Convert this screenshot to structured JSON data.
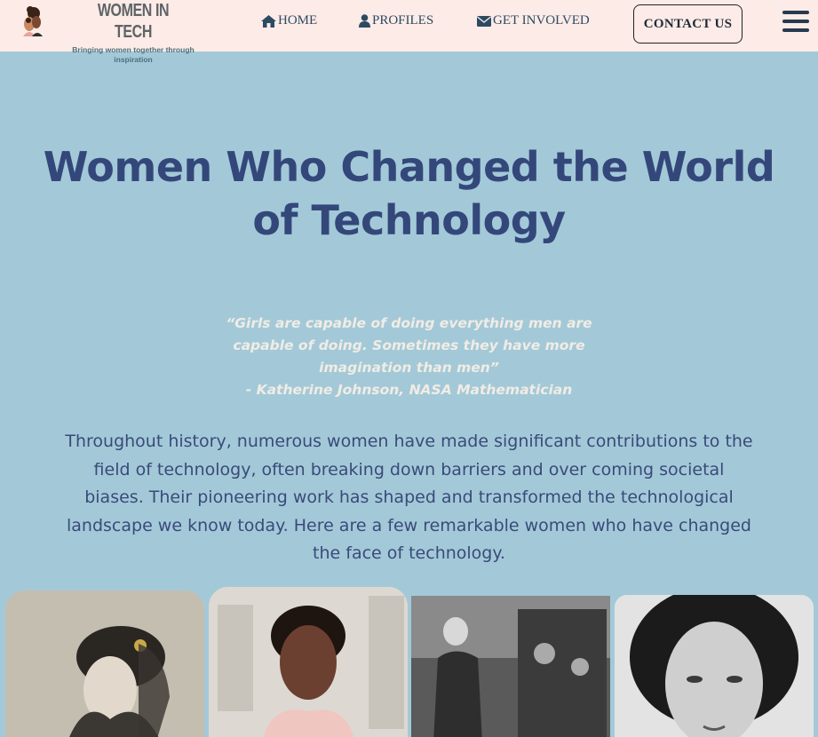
{
  "header": {
    "brand_title": "WOMEN IN TECH",
    "brand_tagline": "Bringing women together through inspiration",
    "nav": [
      {
        "label": "HOME",
        "icon": "home-icon"
      },
      {
        "label": "PROFILES",
        "icon": "user-icon"
      },
      {
        "label": "GET INVOLVED",
        "icon": "envelope-icon"
      }
    ],
    "contact_label": "CONTACT US",
    "menu_icon": "hamburger-icon"
  },
  "hero": {
    "title": "Women Who Changed the World of Technology",
    "quote_lines": [
      "“Girls are capable of doing everything men are",
      "capable of doing. Sometimes they have more",
      "imagination than men”",
      "- Katherine Johnson, NASA Mathematician"
    ],
    "intro": "Throughout history, numerous women have made significant contributions to the field of technology, often breaking down barriers and over coming societal biases. Their pioneering work has shaped and transformed the technological landscape we know today. Here are a few remarkable women who have changed the face of technology."
  },
  "colors": {
    "header_bg": "#fcebe6",
    "page_bg": "#a3c9d8",
    "title": "#34477a",
    "quote": "#f1ece4",
    "nav_text": "#2d4a63"
  }
}
